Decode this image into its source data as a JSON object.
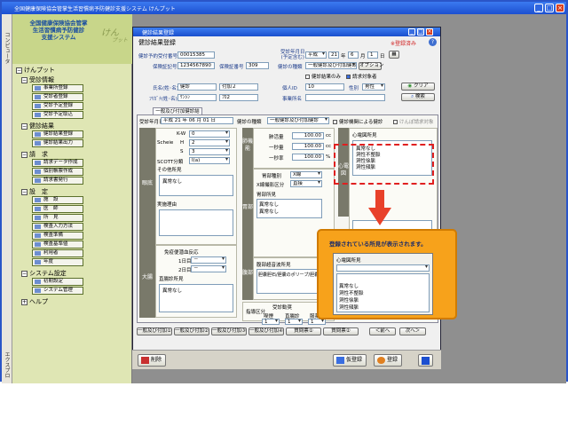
{
  "system": {
    "title": "全国健康保険協会管掌生活習慣病予防健診支援システム けんプット"
  },
  "stripe": {
    "top_label": "コンピュータ",
    "bottom_label": "エクスプロ"
  },
  "sidebar": {
    "title": "全国健康保険協会管掌\n生活習慣病予防健診\n支援システム",
    "logo": "けん",
    "logo_sub": "プット",
    "root": "けんプット",
    "sections": [
      {
        "label": "受診情報",
        "items": [
          "事業所登録",
          "受診者登録",
          "受診予定登録",
          "受診予定取込"
        ]
      },
      {
        "label": "健診結果",
        "items": [
          "健診結果登録",
          "健診結果出力"
        ]
      },
      {
        "label": "請　求",
        "items": [
          "請求データ作成",
          "個別帳票作成",
          "請求書発行"
        ]
      },
      {
        "label": "設　定",
        "items": [
          "施　設",
          "医　師",
          "所　見",
          "検査入力方法",
          "検査準備",
          "検査基準値",
          "利用者",
          "年度"
        ]
      },
      {
        "label": "システム設定",
        "items": [
          "初期設定",
          "システム管理"
        ]
      },
      {
        "label": "ヘルプ",
        "items": []
      }
    ]
  },
  "window": {
    "title": "健診結果登録",
    "form_name": "健診結果登録",
    "status": "※登録済み",
    "help": "?",
    "fields": {
      "receipt_no_label": "健診予約受付番号",
      "receipt_no": "00015385",
      "insured_no_label": "保険証記号",
      "insured_no": "1234567890",
      "insured_num_label": "保険証番号",
      "insured_num": "309",
      "visit_date_label": "受診年月日\n(予定含む)",
      "visit_era": "平成",
      "visit_year": "21",
      "visit_month": "6",
      "visit_day": "1",
      "y": "年",
      "m": "月",
      "d": "日",
      "kind_label": "健診の種類",
      "kind": "一般健診及び付加健診",
      "option_btn": "オプション",
      "chk_result_only": "健診結果のみ",
      "chk_request": "請求対象者",
      "name_label": "氏名(姓･名)",
      "surname": "健診",
      "given": "付加２",
      "kana_label": "ﾌﾘｶﾞﾅ(姓･名)",
      "kana_sur": "ｹﾝｼﾝ",
      "kana_given": "ﾌｶ2",
      "personal_id_label": "個人ID",
      "personal_id": "10",
      "sex_label": "性別",
      "sex": "男性",
      "office_label": "事業所名",
      "clear_btn": "クリア",
      "search_btn": "検索"
    },
    "tab": "一般及び付加健診結果",
    "subbar": {
      "date_label": "受診年月日",
      "date": "平成 21 年 06 月 01 日",
      "kind_label": "健診の種類",
      "kind": "一般健診及び付加健診",
      "chk1": "健診機関による健診",
      "chk2": "けんぽ請求対象"
    },
    "groups": {
      "eyes": "眼底",
      "ecg": "心電図",
      "chest": "胸部",
      "abdomen": "腹部",
      "stomach": "胃部",
      "colon": "大腸",
      "lung": "肺機能",
      "lung2": "聴力",
      "judge": "判定"
    },
    "eyes": {
      "kw_label": "K-W",
      "kw": "0",
      "scheie_label": "Scheie",
      "h_label": "H",
      "h": "2",
      "s_label": "S",
      "s": "3",
      "scott_label": "SCOTT分類",
      "scott": "I(a)",
      "other_label": "その他所見",
      "finding": "異常なし",
      "reason_label": "実施理由"
    },
    "colon": {
      "immune_label": "免疫便潜血反応",
      "day1_label": "1日目",
      "day1": "－",
      "day2_label": "2日目",
      "day2": "－",
      "exam_label": "直腸診所見",
      "exam": "異常なし"
    },
    "vitals": {
      "row1_label": "肺活量",
      "row1": "100.00",
      "row1_unit": "cc",
      "row2_label": "一秒量",
      "row2": "100.00",
      "row2_unit": "cc",
      "row3_label": "一秒率",
      "row3": "100.00",
      "row3_unit": "%"
    },
    "chest": {
      "type_label": "胃部種別",
      "type": "X線",
      "method_label": "X線撮影区分",
      "method": "直接",
      "finding_label": "胃部所見",
      "finding1": "異常なし",
      "finding2": "異常なし"
    },
    "abd": {
      "label": "腹部超音波所見",
      "text": "胆嚢胆石/胆嚢のポリープ/胆嚢腺筋症/胆嚢壁肥厚"
    },
    "ecg": {
      "label": "心電図所見",
      "items": [
        "異常なし",
        "洞性不整脈",
        "洞性徐脈",
        "洞性頻脈"
      ]
    },
    "judge": {
      "cat_label": "指導区分",
      "risk_label": "受診勧奨",
      "col1": "喫煙",
      "col2": "直腸診",
      "col3": "服薬",
      "v1": "1",
      "v2": "1",
      "v3": "1"
    },
    "bottom_buttons": [
      "一般及び付加①",
      "一般及び付加②",
      "一般及び付加③",
      "一般及び付加④",
      "質問票①",
      "質問票②",
      "＜前へ",
      "次へ＞"
    ],
    "footer": {
      "delete": "削除",
      "temp_save": "仮登録",
      "register": "登録"
    }
  },
  "callout": {
    "text": "登録されている所見が表示されます。",
    "label": "心電図所見",
    "items": [
      "異常なし",
      "洞性不整脈",
      "洞性徐脈",
      "洞性頻脈"
    ]
  },
  "colors": {
    "accent_title": "#1c4fd0",
    "callout": "#f7a21b",
    "arrow": "#e8412a"
  }
}
